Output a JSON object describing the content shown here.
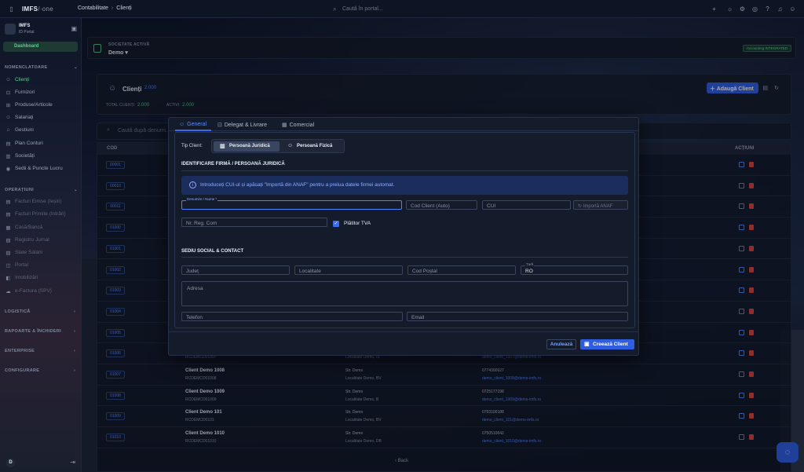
{
  "topbar": {
    "logo_main": "IMFS",
    "logo_sub": "/·one",
    "breadcrumb": [
      "Contabilitate",
      "Clienți"
    ],
    "search_placeholder": "Caută în portal..."
  },
  "sidebar": {
    "brand_name": "IMFS",
    "brand_sub": "ID Portal",
    "dashboard": "Dashboard",
    "sections": {
      "nomenclatoare": "NOMENCLATOARE",
      "operatiuni": "OPERAȚIUNI",
      "logistica": "LOGISTICĂ",
      "rapoarte": "RAPOARTE & ÎNCHIDERI",
      "enterprise": "ENTERPRISE",
      "configurare": "CONFIGURARE"
    },
    "nom_items": [
      "Clienți",
      "Furnizori",
      "Produse/Articole",
      "Salariați",
      "Gestiuni",
      "Plan Conturi",
      "Societăți",
      "Sedii & Puncte Lucru"
    ],
    "op_items": [
      "Facturi Emise (Ieșiri)",
      "Facturi Primite (Intrări)",
      "Casă/Bancă",
      "Registru Jurnal",
      "State Salarii",
      "Portal",
      "Imobilizări",
      "e-Factura (SPV)"
    ],
    "avatar": "D"
  },
  "company": {
    "label": "SOCIETATE ACTIVĂ",
    "value": "Demo",
    "badge": "Accounting INTEGRATED"
  },
  "clients_header": {
    "title": "Clienți",
    "count": "2.000",
    "total_label": "TOTAL CLIENȚI",
    "total_value": "2.000",
    "active_label": "ACTIVI",
    "active_value": "2.000",
    "add_button": "Adaugă Client"
  },
  "table": {
    "search_placeholder": "Caută după denumi...",
    "col_code": "COD",
    "col_actions": "ACȚIUNI",
    "back_label": "Back",
    "codes": [
      "00001",
      "00010",
      "00011",
      "01000",
      "01001",
      "01002",
      "01003",
      "01004",
      "01005",
      "01006",
      "01007",
      "01008",
      "01009",
      "01010"
    ],
    "rows": [
      {
        "name": "",
        "cui": "RCDEMCD01006",
        "street": "",
        "loc": "Localitate Demo, IS",
        "phone": "",
        "email": "demo_client_1006@demo-imfs.ro"
      },
      {
        "name": "Client Demo 1007",
        "cui": "RCDEMCD01007",
        "street": "Str. Demo",
        "loc": "Localitate Demo, IS",
        "phone": "0741344897",
        "email": "demo_client_1007@demo-imfs.ro"
      },
      {
        "name": "Client Demo 1008",
        "cui": "RCDEMCD01008",
        "street": "Str. Demo",
        "loc": "Localitate Demo, BV",
        "phone": "0774300627",
        "email": "demo_client_1008@demo-imfs.ro"
      },
      {
        "name": "Client Demo 1009",
        "cui": "RCDEMCD01009",
        "street": "Str. Demo",
        "loc": "Localitate Demo, B",
        "phone": "0725177198",
        "email": "demo_client_1009@demo-imfs.ro"
      },
      {
        "name": "Client Demo 101",
        "cui": "RCDEMCD0101",
        "street": "Str. Demo",
        "loc": "Localitate Demo, BV",
        "phone": "0793100188",
        "email": "demo_client_101@demo-imfs.ro"
      },
      {
        "name": "Client Demo 1010",
        "cui": "RCDEMCD01010",
        "street": "Str. Demo",
        "loc": "Localitate Demo, DB",
        "phone": "0750510642",
        "email": "demo_client_1010@demo-imfs.ro"
      }
    ]
  },
  "modal": {
    "tabs": [
      "General",
      "Delegat & Livrare",
      "Comercial"
    ],
    "tip_client_label": "Tip Client:",
    "type_options": [
      "Persoană Juridică",
      "Persoană Fizică"
    ],
    "section_id": "IDENTIFICARE FIRMĂ / PERSOANĂ JURIDICĂ",
    "info_text": "Introduceți CUI-ul și apăsați \"Importă din ANAF\" pentru a prelua datele firmei automat.",
    "field_name_label": "Denumire / Nume *",
    "field_code": "Cod Client (Auto)",
    "field_cui": "CUI",
    "anaf_button": "Importă ANAF",
    "field_regcom": "Nr. Reg. Com",
    "tva_label": "Plătitor TVA",
    "section_contact": "SEDIU SOCIAL & CONTACT",
    "field_judet": "Județ",
    "field_localitate": "Localitate",
    "field_cod_postal": "Cod Poștal",
    "field_tara_label": "Țară",
    "field_tara_value": "RO",
    "field_adresa": "Adresa",
    "field_telefon": "Telefon",
    "field_email": "Email",
    "cancel_button": "Anulează",
    "create_button": "Creează Client"
  }
}
